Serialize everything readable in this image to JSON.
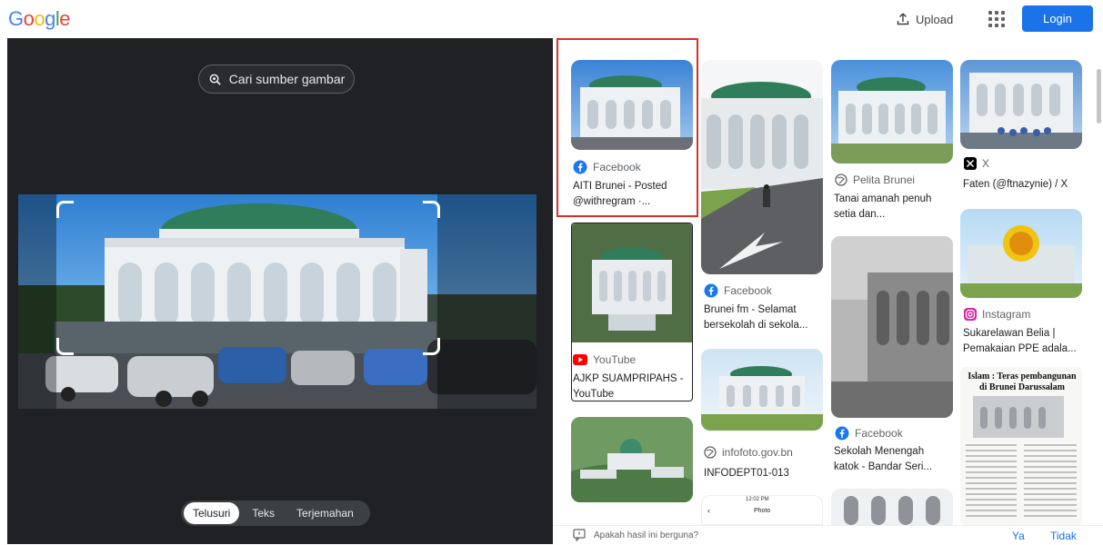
{
  "header": {
    "logo_letters": [
      "G",
      "o",
      "o",
      "g",
      "l",
      "e"
    ],
    "logo_colors": [
      "#4285f4",
      "#ea4335",
      "#fbbc05",
      "#4285f4",
      "#34a853",
      "#ea4335"
    ],
    "upload_label": "Upload",
    "login_label": "Login"
  },
  "left_panel": {
    "source_button": "Cari sumber gambar",
    "modes": [
      "Telusuri",
      "Teks",
      "Terjemahan"
    ],
    "active_mode": "Telusuri"
  },
  "results": [
    {
      "source": "Facebook",
      "source_icon": "facebook-icon",
      "title_lines": [
        "AITI Brunei - Posted",
        "@withregram ·..."
      ],
      "selected": true
    },
    {
      "source": "YouTube",
      "source_icon": "youtube-icon",
      "title_lines": [
        "AJKP SUAMPRIPAHS -",
        "YouTube"
      ]
    },
    {
      "source": "Facebook",
      "source_icon": "facebook-icon",
      "title_lines": [
        "Brunei fm - Selamat",
        "bersekolah di sekola..."
      ]
    },
    {
      "source": "infofoto.gov.bn",
      "source_icon": "globe-icon",
      "title_lines": [
        "INFODEPT01-013"
      ]
    },
    {
      "source": "Pelita Brunei",
      "source_icon": "globe-icon",
      "title_lines": [
        "Tanai amanah penuh",
        "setia dan..."
      ]
    },
    {
      "source": "Facebook",
      "source_icon": "facebook-icon",
      "title_lines": [
        "Sekolah Menengah",
        "katok - Bandar Seri..."
      ]
    },
    {
      "source": "X",
      "source_icon": "x-icon",
      "title_lines": [
        "Faten (@ftnazynie) / X"
      ]
    },
    {
      "source": "Instagram",
      "source_icon": "instagram-icon",
      "title_lines": [
        "Sukarelawan Belia |",
        "Pemakaian PPE adala..."
      ]
    }
  ],
  "newspaper_caption": [
    "Islam : Teras pembangunan",
    "di Brunei Darussalam"
  ],
  "phone_status": "12:02 PM",
  "phone_title": "Photo",
  "feedback": {
    "question": "Apakah hasil ini berguna?",
    "yes": "Ya",
    "no": "Tidak"
  },
  "colors": {
    "accent": "#1a73e8",
    "selection": "#d93025",
    "panel_dark": "#202124",
    "youtube": "#ff0000",
    "facebook": "#1877f2"
  }
}
